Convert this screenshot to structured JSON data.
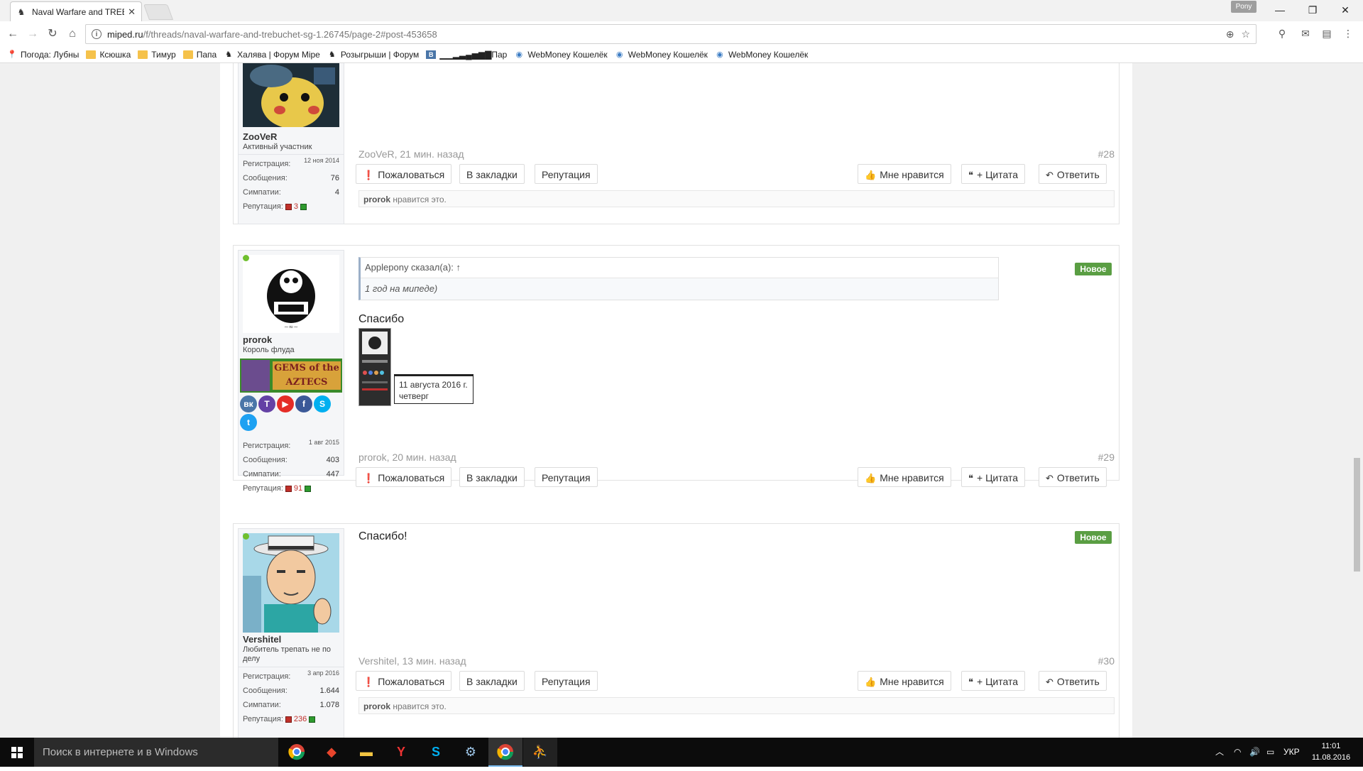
{
  "browser": {
    "tab_title": "Naval Warfare and TREBU",
    "tab_close": "✕",
    "profile": "Pony",
    "window_controls": {
      "minimize": "—",
      "restore": "❐",
      "close": "✕"
    },
    "url_host": "miped.ru",
    "url_path": "/f/threads/naval-warfare-and-trebuchet-sg-1.26745/page-2#post-453658",
    "bookmarks": [
      {
        "icon": "pin-icon",
        "label": "Погода: Лубны"
      },
      {
        "icon": "folder-icon",
        "label": "Ксюшка"
      },
      {
        "icon": "folder-icon",
        "label": "Тимур"
      },
      {
        "icon": "folder-icon",
        "label": "Папа"
      },
      {
        "icon": "miped-icon",
        "label": "Халява | Форум Mipe"
      },
      {
        "icon": "miped-icon",
        "label": "Розыгрыши | Форум"
      },
      {
        "icon": "vk-icon",
        "label": "▁▁▂▃▄▅▆▇Пар"
      },
      {
        "icon": "webmoney-icon",
        "label": "WebMoney Кошелёк"
      },
      {
        "icon": "webmoney-icon",
        "label": "WebMoney Кошелёк"
      },
      {
        "icon": "webmoney-icon",
        "label": "WebMoney Кошелёк"
      }
    ]
  },
  "buttons": {
    "report": "Пожаловаться",
    "bookmark": "В закладки",
    "reputation": "Репутация",
    "like": "Мне нравится",
    "quote": "+ Цитата",
    "reply": "Ответить"
  },
  "stat_labels": {
    "registration": "Регистрация:",
    "messages": "Сообщения:",
    "sympathy": "Симпатии:",
    "reputation": "Репутация:"
  },
  "new_badge": "Новое",
  "posts": [
    {
      "username": "ZooVeR",
      "user_title": "Активный участник",
      "registered": "12 ноя 2014",
      "messages": "76",
      "sympathy": "4",
      "rep_value": "3",
      "meta": "ZooVeR, 21 мин. назад",
      "number": "#28",
      "likes_user": "prorok",
      "likes_text": "нравится это."
    },
    {
      "username": "prorok",
      "user_title": "Король флуда",
      "registered": "1 авг 2015",
      "messages": "403",
      "sympathy": "447",
      "rep_value": "91",
      "quote_author": "Applepony сказал(а): ↑",
      "quote_text": "1 год на мипеде)",
      "body": "Спасибо",
      "cal_date": "11 августа 2016 г.",
      "cal_day": "четверг",
      "banner_text": "GEMS of the AZTECS",
      "meta": "prorok, 20 мин. назад",
      "number": "#29",
      "social": [
        "vk",
        "twitch",
        "youtube",
        "facebook",
        "skype",
        "twitter"
      ]
    },
    {
      "username": "Vershitel",
      "user_title": "Любитель трепать не по делу",
      "registered": "3 апр 2016",
      "messages": "1.644",
      "sympathy": "1.078",
      "rep_value": "236",
      "body": "Спасибо!",
      "meta": "Vershitel, 13 мин. назад",
      "number": "#30",
      "likes_user": "prorok",
      "likes_text": "нравится это."
    }
  ],
  "taskbar": {
    "search_placeholder": "Поиск в интернете и в Windows",
    "language": "УКР",
    "time": "11:01",
    "date": "11.08.2016"
  }
}
